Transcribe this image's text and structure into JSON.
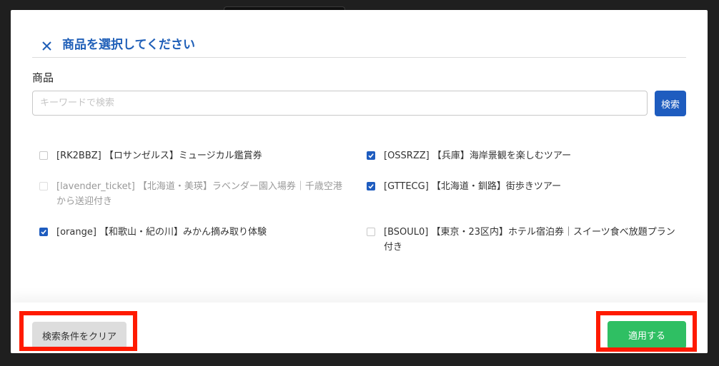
{
  "modal": {
    "title": "商品を選択してください",
    "field_label": "商品",
    "search": {
      "placeholder": "キーワードで検索",
      "value": "",
      "button_label": "検索"
    },
    "products": [
      {
        "label": "[RK2BBZ] 【ロサンゼルス】ミュージカル鑑賞券",
        "checked": false,
        "dim": false
      },
      {
        "label": "[OSSRZZ] 【兵庫】海岸景観を楽しむツアー",
        "checked": true,
        "dim": false
      },
      {
        "label": "[lavender_ticket] 【北海道・美瑛】ラベンダー園入場券｜千歳空港から送迎付き",
        "checked": false,
        "dim": true
      },
      {
        "label": "[GTTECG] 【北海道・釧路】街歩きツアー",
        "checked": true,
        "dim": false
      },
      {
        "label": "[orange] 【和歌山・紀の川】みかん摘み取り体験",
        "checked": true,
        "dim": false
      },
      {
        "label": "[BSOUL0] 【東京・23区内】ホテル宿泊券｜スイーツ食べ放題プラン付き",
        "checked": false,
        "dim": false
      }
    ],
    "footer": {
      "clear_label": "検索条件をクリア",
      "apply_label": "適用する"
    }
  },
  "colors": {
    "title": "#1f5fb8",
    "primary_button": "#1e5cbf",
    "apply_button": "#2fbf63",
    "highlight": "#ff1a00"
  }
}
